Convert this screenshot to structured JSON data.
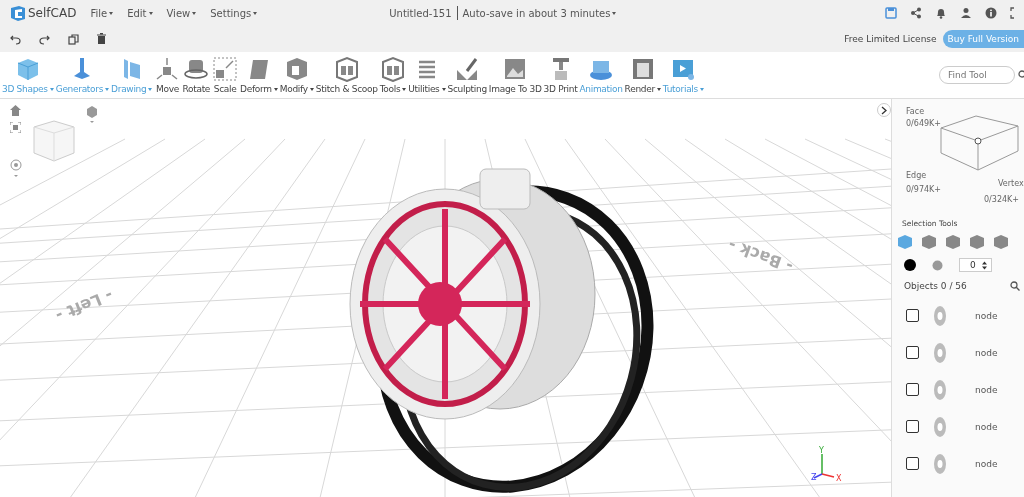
{
  "app": {
    "name": "SelfCAD"
  },
  "menu": [
    {
      "label": "File"
    },
    {
      "label": "Edit"
    },
    {
      "label": "View"
    },
    {
      "label": "Settings"
    }
  ],
  "document": {
    "title": "Untitled-151",
    "autosave": "Auto-save in about 3 minutes"
  },
  "license": {
    "text": "Free Limited License",
    "button": "Buy Full Version"
  },
  "toolbar": [
    {
      "label": "3D Shapes",
      "highlighted": true,
      "dropdown": true
    },
    {
      "label": "Generators",
      "highlighted": true,
      "dropdown": true
    },
    {
      "label": "Drawing",
      "highlighted": true,
      "dropdown": true
    },
    {
      "label": "Move",
      "highlighted": false,
      "dropdown": false
    },
    {
      "label": "Rotate",
      "highlighted": false,
      "dropdown": false
    },
    {
      "label": "Scale",
      "highlighted": false,
      "dropdown": false
    },
    {
      "label": "Deform",
      "highlighted": false,
      "dropdown": true
    },
    {
      "label": "Modify",
      "highlighted": false,
      "dropdown": true
    },
    {
      "label": "Stitch & Scoop",
      "highlighted": false,
      "dropdown": false
    },
    {
      "label": "Tools",
      "highlighted": false,
      "dropdown": true
    },
    {
      "label": "Utilities",
      "highlighted": false,
      "dropdown": true
    },
    {
      "label": "Sculpting",
      "highlighted": false,
      "dropdown": false
    },
    {
      "label": "Image To 3D",
      "highlighted": false,
      "dropdown": false
    },
    {
      "label": "3D Print",
      "highlighted": false,
      "dropdown": false
    },
    {
      "label": "Animation",
      "highlighted": true,
      "dropdown": false
    },
    {
      "label": "Render",
      "highlighted": false,
      "dropdown": true
    },
    {
      "label": "Tutorials",
      "highlighted": true,
      "dropdown": true
    }
  ],
  "find_tool": {
    "placeholder": "Find Tool"
  },
  "viewport": {
    "floor_labels": [
      "- Left -",
      "- Back -"
    ],
    "axes": [
      "X",
      "Y",
      "Z"
    ]
  },
  "selection_panel": {
    "face": {
      "label": "Face",
      "count": "0/649K+"
    },
    "edge": {
      "label": "Edge",
      "count": "0/974K+"
    },
    "vertex": {
      "label": "Vertex",
      "count": "0/324K+"
    },
    "title": "Selection Tools",
    "modes": [
      {
        "selected": true
      },
      {
        "selected": false
      },
      {
        "selected": false
      },
      {
        "selected": false
      },
      {
        "selected": false
      }
    ],
    "spinner": "0"
  },
  "objects": {
    "title": "Objects 0 / 56",
    "items": [
      {
        "name": "node",
        "checked": false
      },
      {
        "name": "node",
        "checked": false
      },
      {
        "name": "node",
        "checked": false
      },
      {
        "name": "node",
        "checked": false
      },
      {
        "name": "node",
        "checked": false
      }
    ]
  }
}
